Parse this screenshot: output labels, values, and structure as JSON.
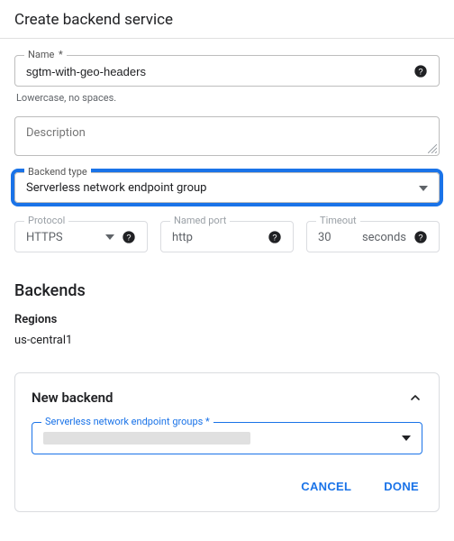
{
  "title": "Create backend service",
  "name": {
    "label": "Name",
    "value": "sgtm-with-geo-headers",
    "help": "Lowercase, no spaces."
  },
  "description": {
    "placeholder": "Description"
  },
  "backendType": {
    "label": "Backend type",
    "value": "Serverless network endpoint group"
  },
  "protocol": {
    "label": "Protocol",
    "value": "HTTPS"
  },
  "namedPort": {
    "label": "Named port",
    "value": "http"
  },
  "timeout": {
    "label": "Timeout",
    "value": "30",
    "unit": "seconds"
  },
  "backends": {
    "heading": "Backends",
    "regionsLabel": "Regions",
    "region": "us-central1",
    "newBackend": {
      "title": "New backend",
      "negLabel": "Serverless network endpoint groups",
      "cancel": "CANCEL",
      "done": "DONE"
    }
  },
  "colors": {
    "accent": "#1a73e8"
  }
}
